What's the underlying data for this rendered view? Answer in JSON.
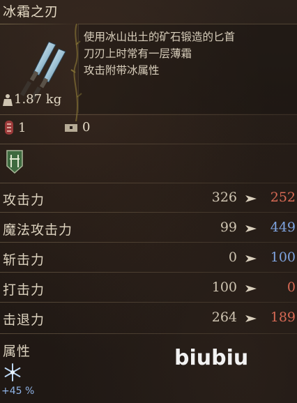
{
  "item": {
    "name": "冰霜之刃",
    "description": [
      "使用冰山出土的矿石锻造的匕首",
      "刀刃上时常有一层薄霜",
      "攻击附带冰属性"
    ],
    "weight": "1.87 kg"
  },
  "inventory": {
    "item_count": "1",
    "chest_count": "0"
  },
  "stats": [
    {
      "label": "攻击力",
      "base": "326",
      "new": "252",
      "new_color": "#d86a55"
    },
    {
      "label": "魔法攻击力",
      "base": "99",
      "new": "449",
      "new_color": "#7fa4e0"
    },
    {
      "label": "斩击力",
      "base": "0",
      "new": "100",
      "new_color": "#7fa4e0"
    },
    {
      "label": "打击力",
      "base": "100",
      "new": "0",
      "new_color": "#d86a55"
    },
    {
      "label": "击退力",
      "base": "264",
      "new": "189",
      "new_color": "#d86a55"
    }
  ],
  "attributes": {
    "label": "属性",
    "frost_percent": "+45 %"
  },
  "watermark": "biubiu",
  "icons": [
    "dagger-icon",
    "weight-icon",
    "rune-icon",
    "chest-icon",
    "shield-badge-icon",
    "arrow-right-icon",
    "frost-icon"
  ]
}
